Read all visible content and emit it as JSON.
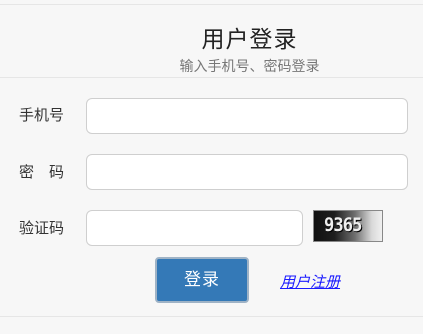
{
  "header": {
    "title": "用户登录",
    "subtitle": "输入手机号、密码登录"
  },
  "form": {
    "phone": {
      "label": "手机号",
      "value": "",
      "placeholder": ""
    },
    "password": {
      "label": "密　码",
      "value": "",
      "placeholder": ""
    },
    "captcha": {
      "label": "验证码",
      "value": "",
      "placeholder": "",
      "image_text": "9365"
    }
  },
  "actions": {
    "login_label": "登录",
    "register_label": "用户注册"
  },
  "colors": {
    "page_background": "#f7f7f7",
    "button_background": "#3479b7",
    "link_color": "#1a1aff"
  }
}
